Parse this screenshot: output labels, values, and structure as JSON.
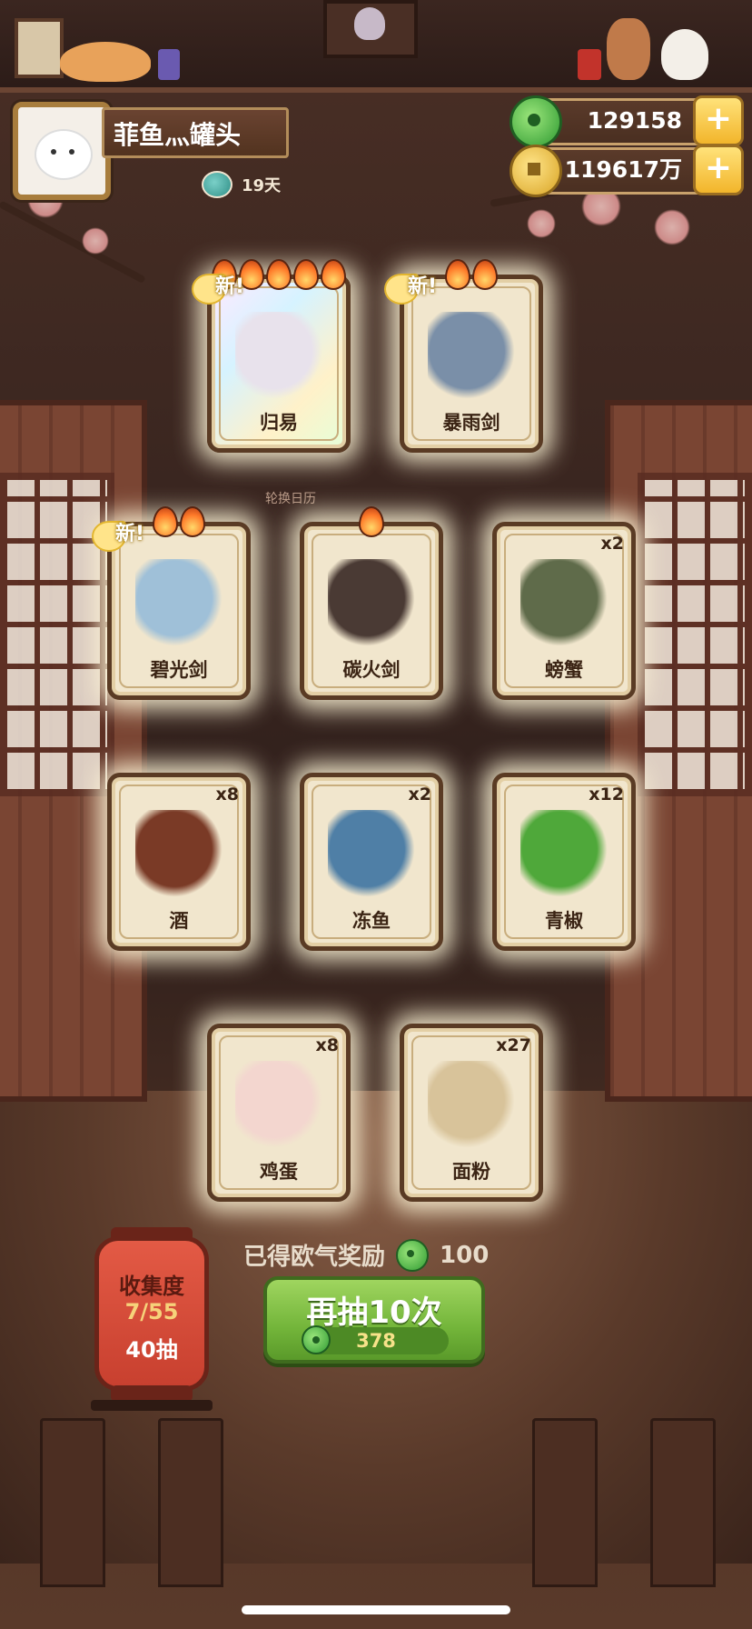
{
  "player": {
    "name": "菲鱼灬罐头",
    "days": "19天"
  },
  "currency": {
    "jade": {
      "icon": "jade-coin-icon",
      "value": "129158"
    },
    "gold": {
      "icon": "gold-coin-icon",
      "value": "119617万"
    }
  },
  "rotate_label": "轮换日历",
  "new_badge": "新!",
  "cards": [
    {
      "name": "归易",
      "flames": 5,
      "new": true,
      "qty": ""
    },
    {
      "name": "暴雨剑",
      "flames": 2,
      "new": true,
      "qty": ""
    },
    {
      "name": "碧光剑",
      "flames": 2,
      "new": true,
      "qty": ""
    },
    {
      "name": "碳火剑",
      "flames": 1,
      "new": false,
      "qty": ""
    },
    {
      "name": "螃蟹",
      "flames": 0,
      "new": false,
      "qty": "x2"
    },
    {
      "name": "酒",
      "flames": 0,
      "new": false,
      "qty": "x8"
    },
    {
      "name": "冻鱼",
      "flames": 0,
      "new": false,
      "qty": "x2"
    },
    {
      "name": "青椒",
      "flames": 0,
      "new": false,
      "qty": "x12"
    },
    {
      "name": "鸡蛋",
      "flames": 0,
      "new": false,
      "qty": "x8"
    },
    {
      "name": "面粉",
      "flames": 0,
      "new": false,
      "qty": "x27"
    }
  ],
  "reward": {
    "label": "已得欧气奖励",
    "value": "100"
  },
  "draw_button": {
    "label": "再抽10次",
    "cost": "378"
  },
  "collection": {
    "title": "收集度",
    "progress": "7/55",
    "draws": "40抽"
  },
  "colors": {
    "button_green": "#73b53a",
    "lantern_red": "#c8402f",
    "card_bg": "#f1e6cd"
  }
}
